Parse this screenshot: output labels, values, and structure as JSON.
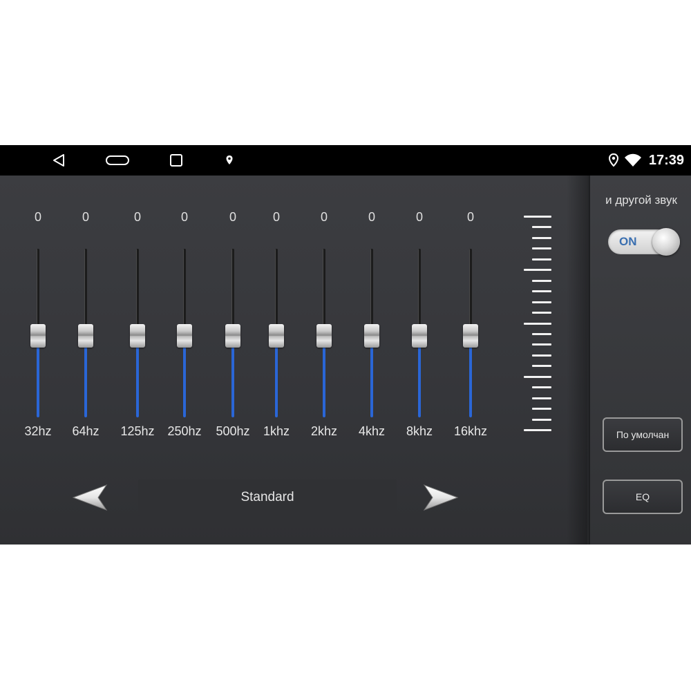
{
  "status_bar": {
    "time": "17:39",
    "nav_icons": [
      "back-icon",
      "home-icon",
      "recents-icon",
      "location-pin-icon"
    ],
    "status_icons": [
      "location-icon",
      "wifi-icon"
    ]
  },
  "equalizer": {
    "bands": [
      {
        "label": "32hz",
        "value": "0",
        "level": 0.5
      },
      {
        "label": "64hz",
        "value": "0",
        "level": 0.5
      },
      {
        "label": "125hz",
        "value": "0",
        "level": 0.5
      },
      {
        "label": "250hz",
        "value": "0",
        "level": 0.5
      },
      {
        "label": "500hz",
        "value": "0",
        "level": 0.5
      },
      {
        "label": "1khz",
        "value": "0",
        "level": 0.5
      },
      {
        "label": "2khz",
        "value": "0",
        "level": 0.5
      },
      {
        "label": "4khz",
        "value": "0",
        "level": 0.5
      },
      {
        "label": "8khz",
        "value": "0",
        "level": 0.5
      },
      {
        "label": "16khz",
        "value": "0",
        "level": 0.5
      }
    ],
    "fill_color": "#2a66d6",
    "preset": "Standard",
    "prev_icon": "arrow-left-icon",
    "next_icon": "arrow-right-icon"
  },
  "side_panel": {
    "other_sound_label": "и другой звук",
    "toggle_label": "ON",
    "default_button": "По умолчан",
    "eq_button": "EQ"
  }
}
